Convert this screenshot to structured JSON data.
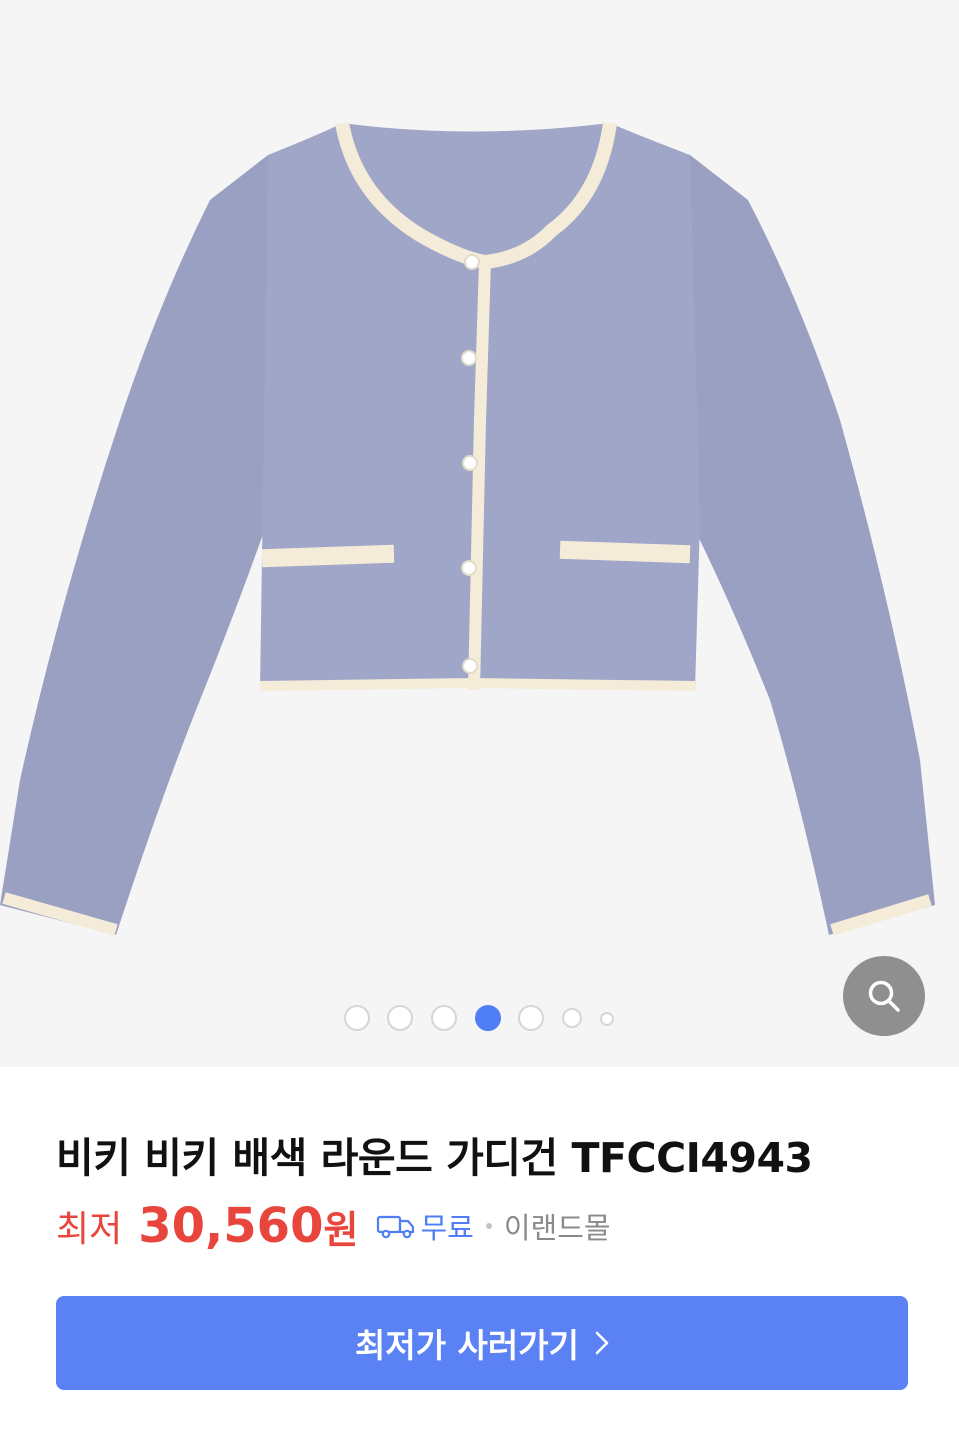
{
  "product": {
    "image_alt": "비키 비키 배색 라운드 가디건 TFCCI4943",
    "title": "비키 비키 배색 라운드 가디건 TFCCI4943",
    "image_count": 7,
    "active_image_index": 3
  },
  "price": {
    "label": "최저",
    "value": "30,560",
    "unit": "원"
  },
  "shipping": {
    "icon": "delivery-truck-icon",
    "text": "무료"
  },
  "seller": "이랜드몰",
  "cta": {
    "label": "최저가 사러가기",
    "icon": "chevron-right-icon"
  },
  "zoom": {
    "icon": "search-icon"
  },
  "colors": {
    "accent": "#4f7ef5",
    "price": "#e8453c",
    "button": "#5a82f4",
    "garment": "#9ea4c5",
    "trim": "#f4ecd9"
  }
}
